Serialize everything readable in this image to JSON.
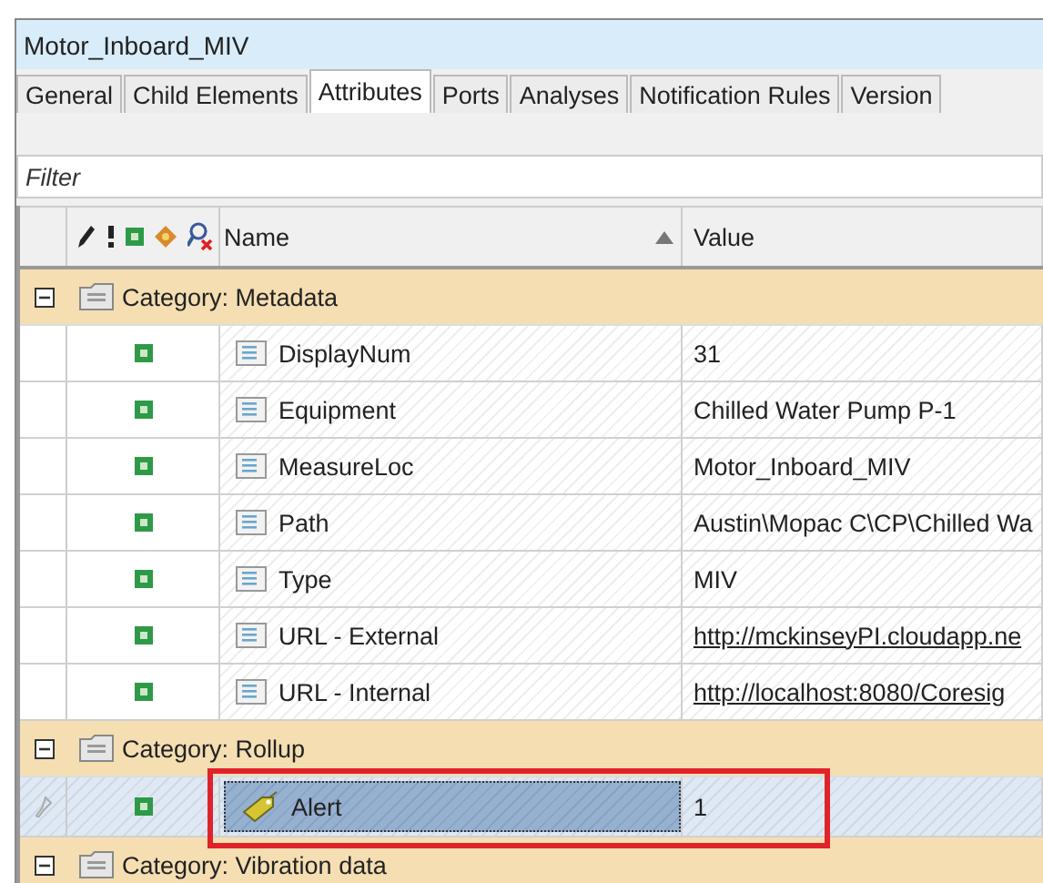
{
  "window": {
    "title": "Motor_Inboard_MIV"
  },
  "tabs": [
    {
      "label": "General",
      "selected": false
    },
    {
      "label": "Child Elements",
      "selected": false
    },
    {
      "label": "Attributes",
      "selected": true
    },
    {
      "label": "Ports",
      "selected": false
    },
    {
      "label": "Analyses",
      "selected": false
    },
    {
      "label": "Notification Rules",
      "selected": false
    },
    {
      "label": "Version",
      "selected": false
    }
  ],
  "filter": {
    "placeholder": "Filter"
  },
  "columns": [
    "Name",
    "Value"
  ],
  "groups": [
    {
      "label": "Category: Metadata",
      "expanded": true,
      "attributes": [
        {
          "name": "DisplayNum",
          "value": "31",
          "kind": "text",
          "selected": false
        },
        {
          "name": "Equipment",
          "value": "Chilled Water Pump P-1",
          "kind": "text",
          "selected": false
        },
        {
          "name": "MeasureLoc",
          "value": "Motor_Inboard_MIV",
          "kind": "text",
          "selected": false
        },
        {
          "name": "Path",
          "value": "Austin\\Mopac C\\CP\\Chilled Wa",
          "kind": "text",
          "selected": false
        },
        {
          "name": "Type",
          "value": "MIV",
          "kind": "text",
          "selected": false
        },
        {
          "name": "URL - External",
          "value": "http://mckinseyPI.cloudapp.ne",
          "kind": "link",
          "selected": false
        },
        {
          "name": "URL - Internal",
          "value": "http://localhost:8080/Coresig",
          "kind": "link",
          "selected": false
        }
      ]
    },
    {
      "label": "Category: Rollup",
      "expanded": true,
      "attributes": [
        {
          "name": "Alert",
          "value": "1",
          "kind": "alert",
          "selected": true
        }
      ]
    },
    {
      "label": "Category: Vibration data",
      "expanded": true
    }
  ]
}
